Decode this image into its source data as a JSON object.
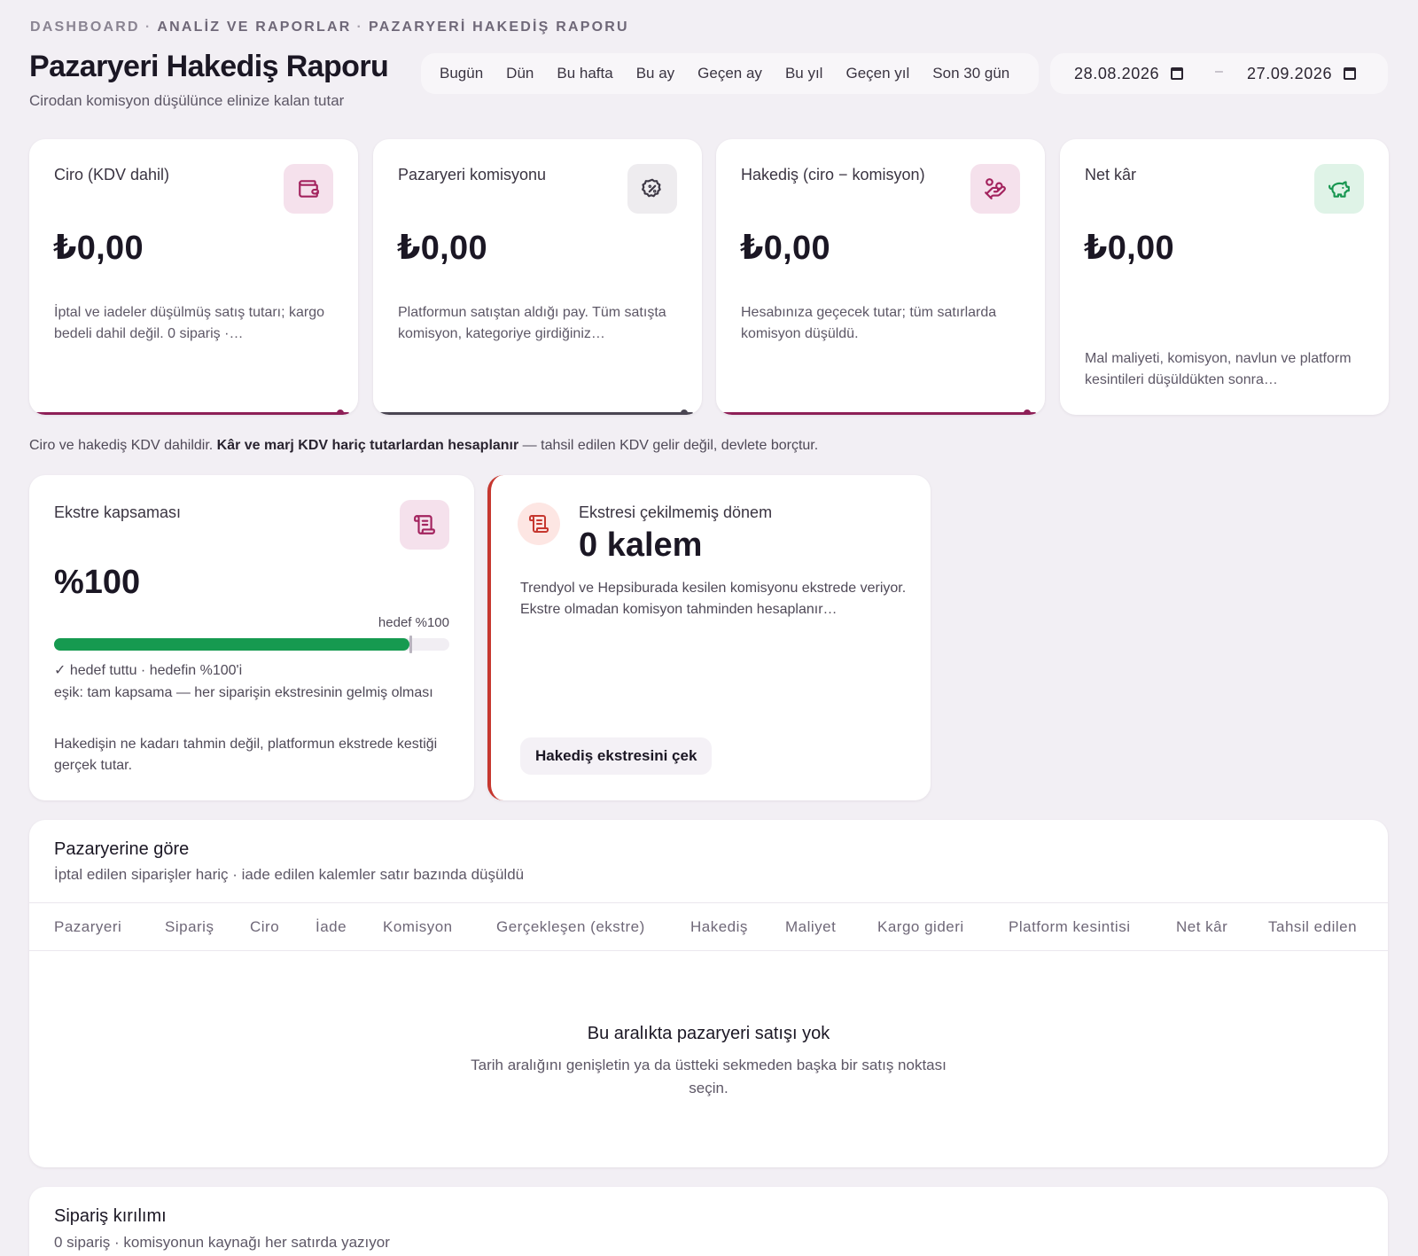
{
  "breadcrumb": [
    "DASHBOARD",
    "ANALİZ VE RAPORLAR",
    "PAZARYERİ HAKEDİŞ RAPORU"
  ],
  "header": {
    "title": "Pazaryeri Hakediş Raporu",
    "subtitle": "Cirodan komisyon düşülünce elinize kalan tutar"
  },
  "range_tabs": [
    "Bugün",
    "Dün",
    "Bu hafta",
    "Bu ay",
    "Geçen ay",
    "Bu yıl",
    "Geçen yıl",
    "Son 30 gün"
  ],
  "date_range": {
    "from": "28.08.2026",
    "separator": "–",
    "to": "27.09.2026"
  },
  "kpis": [
    {
      "label": "Ciro (KDV dahil)",
      "value": "₺0,00",
      "desc": "İptal ve iadeler düşülmüş satış tutarı; kargo bedeli dahil değil. 0 sipariş ·…",
      "icon": "wallet-icon",
      "icon_bg": "#f5e1ec",
      "icon_color": "#a3235e",
      "accent": "#8e1f57"
    },
    {
      "label": "Pazaryeri komisyonu",
      "value": "₺0,00",
      "desc": "Platformun satıştan aldığı pay. Tüm satışta komisyon, kategoriye girdiğiniz…",
      "icon": "percent-badge-icon",
      "icon_bg": "#eeecef",
      "icon_color": "#3d3845",
      "accent": "#4a4552"
    },
    {
      "label": "Hakediş (ciro − komisyon)",
      "value": "₺0,00",
      "desc": "Hesabınıza geçecek tutar; tüm satırlarda komisyon düşüldü.",
      "icon": "hand-coins-icon",
      "icon_bg": "#f5e1ec",
      "icon_color": "#a3235e",
      "accent": "#8e1f57"
    },
    {
      "label": "Net kâr",
      "value": "₺0,00",
      "desc": "Mal maliyeti, komisyon, navlun ve platform kesintileri düşüldükten sonra…",
      "icon": "piggy-bank-icon",
      "icon_bg": "#dff3e7",
      "icon_color": "#179650",
      "accent": ""
    }
  ],
  "kdv_note": {
    "before": "Ciro ve hakediş KDV dahildir. ",
    "bold": "Kâr ve marj KDV hariç tutarlardan hesaplanır",
    "after": " — tahsil edilen KDV gelir değil, devlete borçtur."
  },
  "coverage": {
    "label": "Ekstre kapsaması",
    "value": "%100",
    "target_label": "hedef %100",
    "progress": 0.9,
    "target_marker": 0.9,
    "status": "✓ hedef tuttu · hedefin %100'i",
    "threshold": "eşik: tam kapsama — her siparişin ekstresinin gelmiş olması",
    "note": "Hakedişin ne kadarı tahmin değil, platformun ekstrede kestiği gerçek tutar.",
    "bar_color": "#169a50"
  },
  "statement": {
    "label": "Ekstresi çekilmemiş dönem",
    "value": "0 kalem",
    "desc": "Trendyol ve Hepsiburada kesilen komisyonu ekstrede veriyor. Ekstre olmadan komisyon tahminden hesaplanır…",
    "button": "Hakediş ekstresini çek",
    "accent": "#c6372f"
  },
  "marketplace_table": {
    "title": "Pazaryerine göre",
    "subtitle": "İptal edilen siparişler hariç · iade edilen kalemler satır bazında düşüldü",
    "columns": [
      "Pazaryeri",
      "Sipariş",
      "Ciro",
      "İade",
      "Komisyon",
      "Gerçekleşen (ekstre)",
      "Hakediş",
      "Maliyet",
      "Kargo gideri",
      "Platform kesintisi",
      "Net kâr",
      "Tahsil edilen"
    ],
    "rows": [],
    "empty_title": "Bu aralıkta pazaryeri satışı yok",
    "empty_desc": "Tarih aralığını genişletin ya da üstteki sekmeden başka bir satış noktası seçin."
  },
  "order_breakdown": {
    "title": "Sipariş kırılımı",
    "subtitle": "0 sipariş · komisyonun kaynağı her satırda yazıyor"
  }
}
